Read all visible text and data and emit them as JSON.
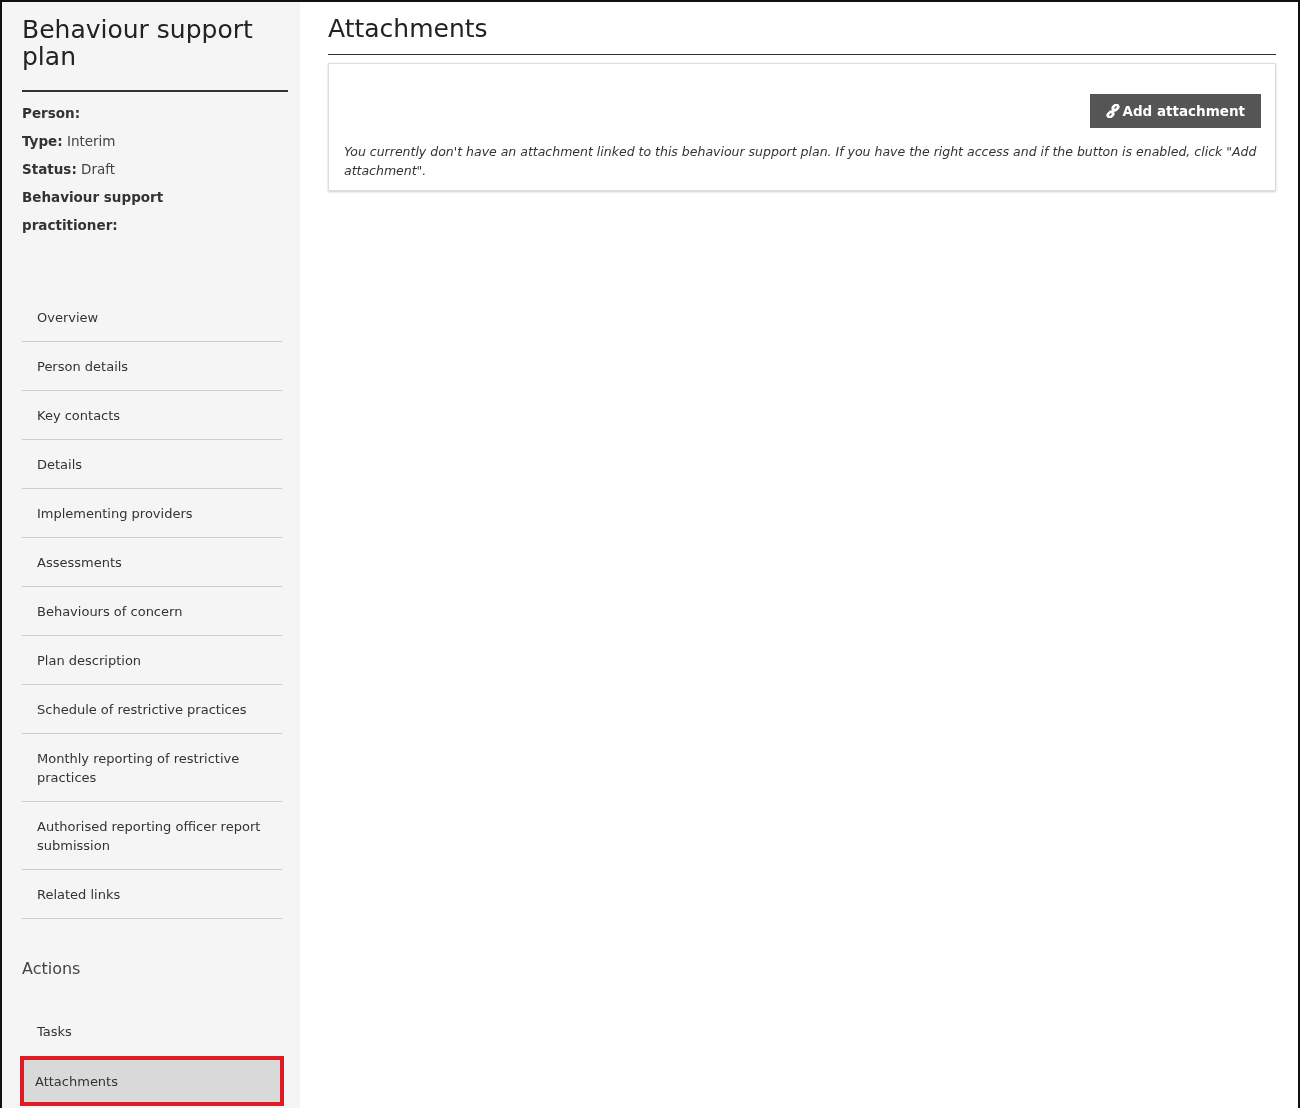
{
  "sidebar": {
    "title": "Behaviour support plan",
    "meta": [
      {
        "label": "Person:"
      },
      {
        "label": "Type:",
        "value": "Interim"
      },
      {
        "label": "Status:",
        "value": "Draft"
      },
      {
        "label": "Behaviour support practitioner:"
      }
    ],
    "nav": [
      {
        "label": "Overview",
        "selected": false
      },
      {
        "label": "Person details",
        "selected": false
      },
      {
        "label": "Key contacts",
        "selected": false
      },
      {
        "label": "Details",
        "selected": false
      },
      {
        "label": "Implementing providers",
        "selected": false
      },
      {
        "label": "Assessments",
        "selected": false
      },
      {
        "label": "Behaviours of concern",
        "selected": false
      },
      {
        "label": "Plan description",
        "selected": false
      },
      {
        "label": "Schedule of restrictive practices",
        "selected": false
      },
      {
        "label": "Monthly reporting of restrictive practices",
        "selected": false
      },
      {
        "label": "Authorised reporting officer report submission",
        "selected": false
      },
      {
        "label": "Related links",
        "selected": false
      }
    ],
    "actions_heading": "Actions",
    "actions": [
      {
        "label": "Tasks",
        "selected": false,
        "highlighted": false
      },
      {
        "label": "Attachments",
        "selected": true,
        "highlighted": true
      }
    ]
  },
  "main": {
    "title": "Attachments",
    "button": "Add attachment",
    "message": "You currently don't have an attachment linked to this behaviour support plan. If you have the right access and if the button is enabled, click \"Add attachment\"."
  }
}
